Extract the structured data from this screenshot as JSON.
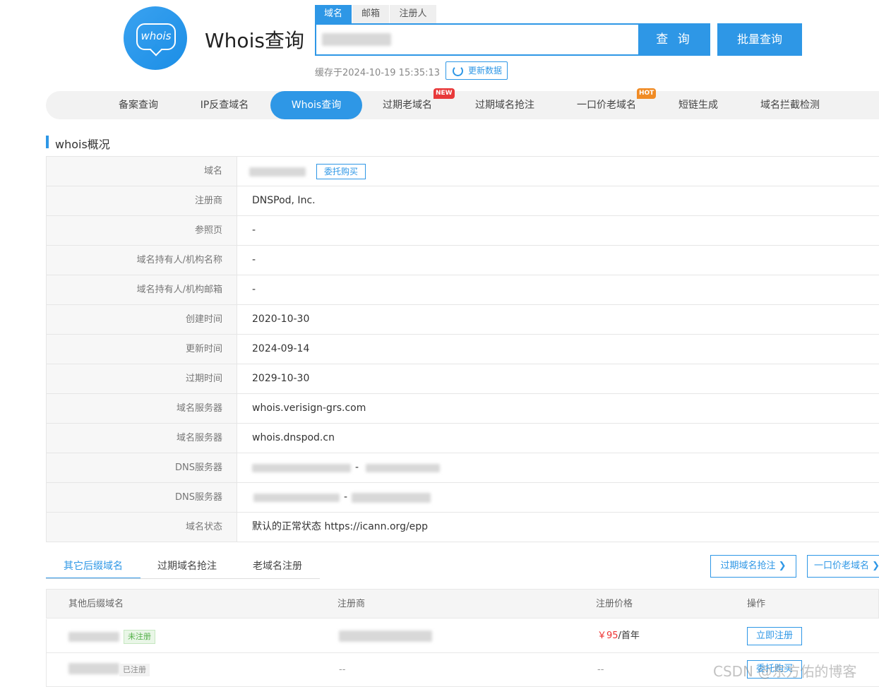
{
  "header": {
    "logo_text": "whois",
    "title": "Whois查询",
    "search_tabs": [
      {
        "label": "域名"
      },
      {
        "label": "邮箱"
      },
      {
        "label": "注册人"
      }
    ],
    "query_button": "查 询",
    "batch_button": "批量查询",
    "cache_text": "缓存于2024-10-19 15:35:13",
    "update_button": "更新数据"
  },
  "nav": {
    "items": [
      {
        "label": "备案查询"
      },
      {
        "label": "IP反查域名"
      },
      {
        "label": "Whois查询"
      },
      {
        "label": "过期老域名",
        "badge": "NEW"
      },
      {
        "label": "过期域名抢注"
      },
      {
        "label": "一口价老域名",
        "badge": "HOT"
      },
      {
        "label": "短链生成"
      },
      {
        "label": "域名拦截检测"
      }
    ]
  },
  "overview": {
    "title": "whois概况",
    "entrust_button": "委托购买",
    "rows": [
      {
        "label": "域名",
        "value": ""
      },
      {
        "label": "注册商",
        "value": "DNSPod, Inc."
      },
      {
        "label": "参照页",
        "value": "-"
      },
      {
        "label": "域名持有人/机构名称",
        "value": "-"
      },
      {
        "label": "域名持有人/机构邮箱",
        "value": "-"
      },
      {
        "label": "创建时间",
        "value": "2020-10-30"
      },
      {
        "label": "更新时间",
        "value": "2024-09-14"
      },
      {
        "label": "过期时间",
        "value": "2029-10-30"
      },
      {
        "label": "域名服务器",
        "value": "whois.verisign-grs.com"
      },
      {
        "label": "域名服务器",
        "value": "whois.dnspod.cn"
      },
      {
        "label": "DNS服务器",
        "value": "-"
      },
      {
        "label": "DNS服务器",
        "value": "-"
      },
      {
        "label": "域名状态",
        "value": "默认的正常状态 https://icann.org/epp"
      }
    ]
  },
  "lower": {
    "tabs": [
      {
        "label": "其它后缀域名"
      },
      {
        "label": "过期域名抢注"
      },
      {
        "label": "老域名注册"
      }
    ],
    "btn_expired": "过期域名抢注 ❯",
    "btn_fixed": "一口价老域名 ❯",
    "columns": [
      "其他后缀域名",
      "注册商",
      "注册价格",
      "操作"
    ],
    "rows": [
      {
        "status": "未注册",
        "price": "￥95",
        "price_unit": "/首年",
        "action": "立即注册",
        "registrar": ""
      },
      {
        "status": "已注册",
        "price": "--",
        "price_unit": "",
        "action": "委托购买",
        "registrar": "--"
      }
    ]
  },
  "watermark": "CSDN @东方佑的博客"
}
